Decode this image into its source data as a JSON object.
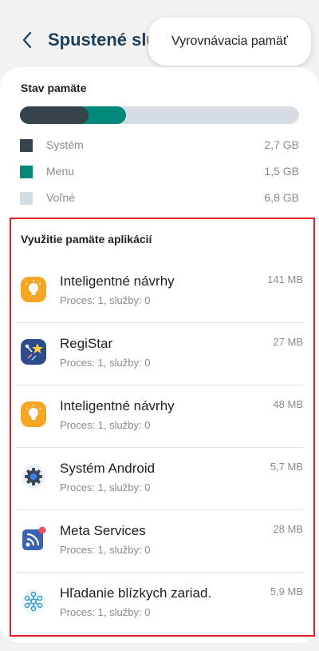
{
  "header": {
    "title": "Spustené služby",
    "popup_label": "Vyrovnávacia pamäť"
  },
  "memory": {
    "title": "Stav pamäte",
    "legend": [
      {
        "label": "Systém",
        "size": "2,7 GB",
        "color": "#37424a"
      },
      {
        "label": "Menu",
        "size": "1,5 GB",
        "color": "#00897b"
      },
      {
        "label": "Voľné",
        "size": "6,8 GB",
        "color": "#d6dde2"
      }
    ],
    "bar_fractions": {
      "system": 0.245,
      "menu": 0.136,
      "free": 0.619
    }
  },
  "apps": {
    "title": "Využitie pamäte aplikácií",
    "items": [
      {
        "name": "Inteligentné návrhy",
        "sub": "Proces: 1, služby: 0",
        "size": "141 MB",
        "icon": "lightbulb-icon"
      },
      {
        "name": "RegiStar",
        "sub": "Proces: 1, služby: 0",
        "size": "27 MB",
        "icon": "registar-icon"
      },
      {
        "name": "Inteligentné návrhy",
        "sub": "Proces: 1, služby: 0",
        "size": "48 MB",
        "icon": "lightbulb-icon"
      },
      {
        "name": "Systém Android",
        "sub": "Proces: 1, služby: 0",
        "size": "5,7 MB",
        "icon": "gear-icon"
      },
      {
        "name": "Meta Services",
        "sub": "Proces: 1, služby: 0",
        "size": "28 MB",
        "icon": "meta-services-icon"
      },
      {
        "name": "Hľadanie blízkych zariad.",
        "sub": "Proces: 1, služby: 0",
        "size": "5,9 MB",
        "icon": "nearby-devices-icon"
      }
    ]
  }
}
